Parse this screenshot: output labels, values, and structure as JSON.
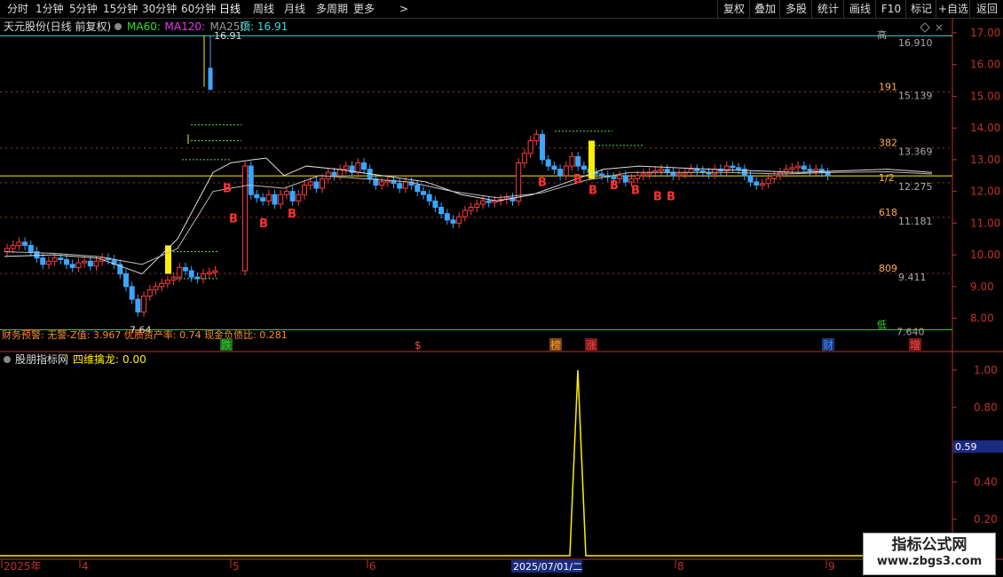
{
  "toolbar": {
    "periods": [
      "分时",
      "1分钟",
      "5分钟",
      "15分钟",
      "30分钟",
      "60分钟",
      "日线",
      "周线",
      "月线",
      "多周期",
      "更多"
    ],
    "active_period": "日线",
    "more_arrow": ">",
    "right_buttons": [
      "复权",
      "叠加",
      "多股",
      "统计",
      "画线",
      "F10",
      "标记",
      "+自选",
      "返回"
    ]
  },
  "main_panel": {
    "stock_title": "天元股份(日线 前复权)",
    "ma_labels": [
      {
        "text": "MA60:",
        "color": "#33dd33"
      },
      {
        "text": "MA120:",
        "color": "#ee33ee"
      },
      {
        "text": "MA250:",
        "color": "#999999"
      }
    ],
    "top_label": "顶: 16.91",
    "finance_warning": "财务预警: 无警-Z值: 3.967 优质资产率: 0.74 现金负债比: 0.281",
    "price_ticks": [
      "17.00",
      "16.00",
      "15.00",
      "14.00",
      "13.00",
      "12.00",
      "11.00",
      "10.00",
      "9.00",
      "8.00"
    ],
    "fib_levels": [
      {
        "ratio": "191",
        "price": "15.139",
        "y": 15.139
      },
      {
        "ratio": "382",
        "price": "13.369",
        "y": 13.369
      },
      {
        "ratio": "1/2",
        "price": "12.275",
        "y": 12.275
      },
      {
        "ratio": "618",
        "price": "11.181",
        "y": 11.181
      },
      {
        "ratio": "809",
        "price": "9.411",
        "y": 9.411
      }
    ],
    "high_line": {
      "ratio": "高",
      "price": "16.910",
      "y": 16.91
    },
    "low_line": {
      "ratio": "低",
      "price": "7.640",
      "y": 7.64
    },
    "peak_label": "16.91",
    "trough_label": "7.64",
    "buy_signal": "B",
    "events": [
      {
        "label": "跌",
        "color": "#33cc33"
      },
      {
        "label": "$",
        "color": "#ff4444"
      },
      {
        "label": "榜",
        "color": "#ff9933"
      },
      {
        "label": "涨",
        "color": "#ff4444"
      },
      {
        "label": "财",
        "color": "#4488ff"
      },
      {
        "label": "增",
        "color": "#ff4444"
      }
    ]
  },
  "indicator_panel": {
    "title": "股朋指标网",
    "indicator_name": "四维擒龙:",
    "indicator_value": "0.00",
    "y_ticks": [
      "1.00",
      "0.80",
      "0.60",
      "0.40",
      "0.20"
    ],
    "cursor_value": "0.59",
    "signal_values": [
      0,
      0,
      0,
      0,
      1,
      0,
      0,
      0,
      0
    ]
  },
  "date_axis": {
    "labels": [
      "2025年",
      "4",
      "5",
      "6",
      "7",
      "8",
      "9"
    ],
    "highlight_date": "2025/07/01/二"
  },
  "watermark": {
    "line1": "指标公式网",
    "line2": "www.zbgs3.com"
  },
  "colors": {
    "up": "#ff3b3b",
    "down": "#3aa7ff",
    "axis": "#c0302b",
    "yellow": "#ffee00",
    "cyan_line": "#33dddd"
  }
}
